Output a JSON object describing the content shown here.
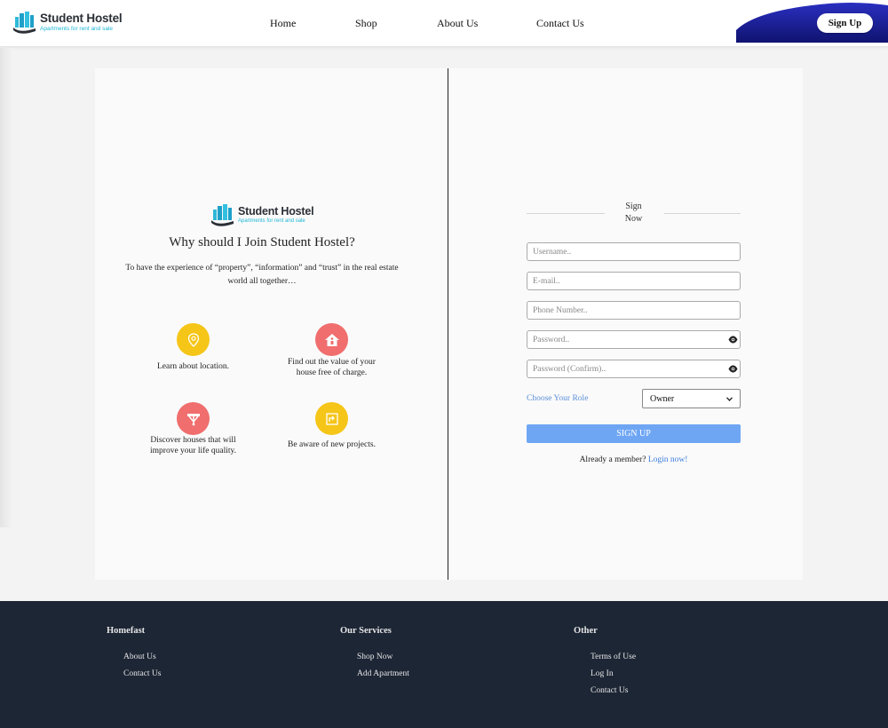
{
  "header": {
    "logo": {
      "title": "Student Hostel",
      "subtitle": "Apartments for rent and sale"
    },
    "nav": [
      "Home",
      "Shop",
      "About Us",
      "Contact Us"
    ],
    "signup_label": "Sign Up",
    "wave_color": "#1a1f9e"
  },
  "left_panel": {
    "logo": {
      "title": "Student Hostel",
      "subtitle": "Apartments for rent and sale"
    },
    "heading": "Why should I Join Student Hostel?",
    "intro": "To have the experience of “property”, “information” and “trust” in the real estate world all together…",
    "features": [
      {
        "icon": "location-pin-icon",
        "color": "#f5c518",
        "text": "Learn about location."
      },
      {
        "icon": "house-value-icon",
        "color": "#f06e6e",
        "text": "Find out the value of your house free of charge."
      },
      {
        "icon": "chandelier-icon",
        "color": "#f06e6e",
        "text": "Discover houses that will improve your life quality."
      },
      {
        "icon": "project-board-icon",
        "color": "#f5c518",
        "text": "Be aware of new projects."
      }
    ]
  },
  "form": {
    "title": "Sign Now",
    "username_placeholder": "Username..",
    "email_placeholder": "E-mail..",
    "phone_placeholder": "Phone Number..",
    "password_placeholder": "Password..",
    "password_confirm_placeholder": "Password (Confirm)..",
    "role_label": "Choose Your Role",
    "role_selected": "Owner",
    "submit_label": "SIGN UP",
    "member_text": "Already a member?",
    "login_link": "Login now!",
    "accent": "#6ea6f4"
  },
  "footer": {
    "columns": [
      {
        "title": "Homefast",
        "links": [
          "About Us",
          "Contact Us"
        ]
      },
      {
        "title": "Our Services",
        "links": [
          "Shop Now",
          "Add Apartment"
        ]
      },
      {
        "title": "Other",
        "links": [
          "Terms of Use",
          "Log In",
          "Contact Us"
        ]
      }
    ],
    "background": "#1d2635"
  }
}
